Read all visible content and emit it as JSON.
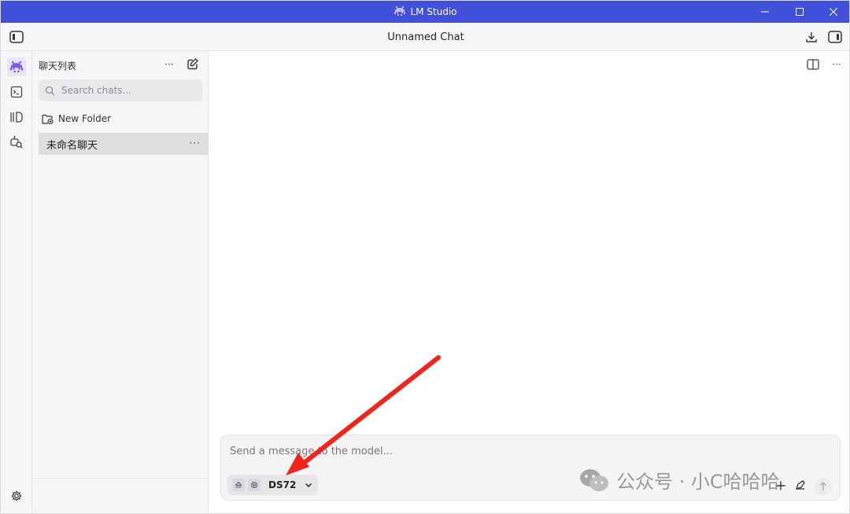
{
  "window": {
    "app_title": "LM Studio",
    "title_bar_color": "#4050d9"
  },
  "toolbar": {
    "chat_title": "Unnamed Chat"
  },
  "sidebar": {
    "header": "聊天列表",
    "more": "···",
    "search_placeholder": "Search chats...",
    "new_folder": "New Folder",
    "chats": [
      {
        "title": "未命名聊天",
        "more": "···",
        "selected": true
      }
    ]
  },
  "main": {
    "message_placeholder": "Send a message to the model...",
    "model_name": "DS72",
    "more": "···"
  },
  "overlay": {
    "watermark": "公众号 · 小C哈哈哈",
    "arrow_color": "#f0241d"
  },
  "colors": {
    "accent": "#4050d9",
    "rail_active_icon": "#7a5ae6"
  }
}
